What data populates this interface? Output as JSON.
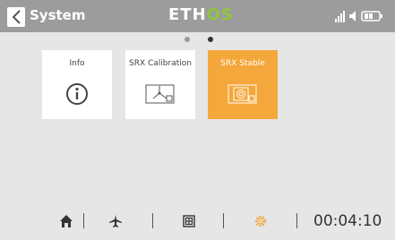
{
  "header": {
    "title": "System",
    "logo_left": "ETH",
    "logo_right": "OS",
    "icons": [
      "back-icon",
      "signal-icon",
      "speaker-icon",
      "battery-icon"
    ]
  },
  "pager": {
    "pages": 2,
    "current": 2
  },
  "tiles": [
    {
      "label": "Info",
      "icon": "info-icon",
      "selected": false
    },
    {
      "label": "SRX Calibration",
      "icon": "calibration-icon",
      "selected": false
    },
    {
      "label": "SRX Stable",
      "icon": "stable-icon",
      "selected": true
    }
  ],
  "bottom_bar": {
    "icons": [
      "home-icon",
      "airplane-icon",
      "widgets-icon",
      "settings-gear-icon"
    ],
    "timer": "00:04:10"
  },
  "colors": {
    "header_bg": "#9c9c9c",
    "accent": "#f4a73a",
    "logo_green": "#8ec63f",
    "background": "#e6e6e6"
  }
}
